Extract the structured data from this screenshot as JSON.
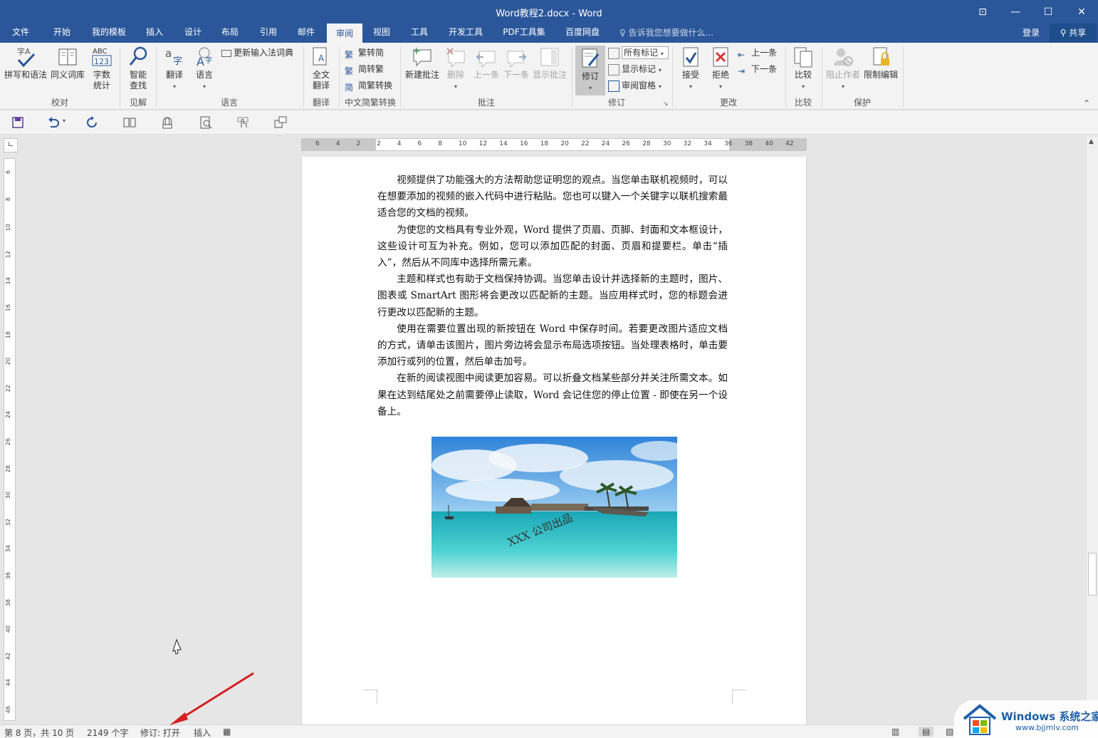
{
  "window": {
    "title": "Word教程2.docx - Word",
    "buttons": [
      "⊡",
      "—",
      "☐",
      "✕"
    ]
  },
  "tabs": [
    {
      "label": "文件"
    },
    {
      "label": "开始"
    },
    {
      "label": "我的模板"
    },
    {
      "label": "插入"
    },
    {
      "label": "设计"
    },
    {
      "label": "布局"
    },
    {
      "label": "引用"
    },
    {
      "label": "邮件"
    },
    {
      "label": "审阅",
      "active": true
    },
    {
      "label": "视图"
    },
    {
      "label": "工具"
    },
    {
      "label": "开发工具"
    },
    {
      "label": "PDF工具集"
    },
    {
      "label": "百度网盘"
    }
  ],
  "tellme": "告诉我您想要做什么...",
  "account": {
    "login": "登录",
    "share": "共享"
  },
  "ribbon": {
    "proofing": {
      "spell": "拼写和语法",
      "thesaurus": "同义词库",
      "wordcount": [
        "字数",
        "统计"
      ],
      "group": "校对"
    },
    "insights": {
      "smart_lookup": [
        "智能",
        "查找"
      ],
      "group": "见解"
    },
    "language": {
      "translate": "翻译",
      "language": "语言",
      "update_ime": "更新输入法词典",
      "group": "语言"
    },
    "translation": {
      "full_translate": [
        "全文",
        "翻译"
      ],
      "group": "翻译"
    },
    "chinese": {
      "to_simplified": "繁转简",
      "to_traditional": "简转繁",
      "convert": "简繁转换",
      "group": "中文简繁转换"
    },
    "comments": {
      "new": "新建批注",
      "delete": "删除",
      "previous": "上一条",
      "next": "下一条",
      "show": "显示批注",
      "group": "批注"
    },
    "tracking": {
      "track": "修订",
      "markup_select": "所有标记",
      "show_markup": "显示标记",
      "pane": "审阅窗格",
      "group": "修订"
    },
    "changes": {
      "accept": "接受",
      "reject": "拒绝",
      "previous": "上一条",
      "next": "下一条",
      "group": "更改"
    },
    "compare": {
      "compare": "比较",
      "group": "比较"
    },
    "protect": {
      "block_authors": "阻止作者",
      "restrict": "限制编辑",
      "group": "保护"
    }
  },
  "ruler": {
    "h_ticks": [
      "6",
      "4",
      "2",
      "2",
      "4",
      "6",
      "8",
      "10",
      "12",
      "14",
      "16",
      "18",
      "20",
      "22",
      "24",
      "26",
      "28",
      "30",
      "32",
      "34",
      "36",
      "38",
      "40",
      "42"
    ],
    "v_ticks": [
      "6",
      "8",
      "10",
      "12",
      "14",
      "16",
      "18",
      "20",
      "22",
      "24",
      "26",
      "28",
      "30",
      "32",
      "34",
      "36",
      "38",
      "40",
      "42",
      "44",
      "46"
    ]
  },
  "document": {
    "paragraphs": [
      "视频提供了功能强大的方法帮助您证明您的观点。当您单击联机视频时，可以在想要添加的视频的嵌入代码中进行粘贴。您也可以键入一个关键字以联机搜索最适合您的文档的视频。",
      "为使您的文档具有专业外观，Word 提供了页眉、页脚、封面和文本框设计，这些设计可互为补充。例如，您可以添加匹配的封面、页眉和提要栏。单击“插入”，然后从不同库中选择所需元素。",
      "主题和样式也有助于文档保持协调。当您单击设计并选择新的主题时，图片、图表或 SmartArt 图形将会更改以匹配新的主题。当应用样式时，您的标题会进行更改以匹配新的主题。",
      "使用在需要位置出现的新按钮在 Word 中保存时间。若要更改图片适应文档的方式，请单击该图片，图片旁边将会显示布局选项按钮。当处理表格时，单击要添加行或列的位置，然后单击加号。",
      "在新的阅读视图中阅读更加容易。可以折叠文档某些部分并关注所需文本。如果在达到结尾处之前需要停止读取，Word 会记住您的停止位置 - 即使在另一个设备上。"
    ],
    "image_watermark": "XXX 公司出品"
  },
  "status": {
    "page": "第 8 页，共 10 页",
    "words": "2149 个字",
    "track": "修订: 打开",
    "mode": "插入"
  },
  "brand": {
    "name": "Windows 系统之家",
    "url": "www.bjjmlv.com"
  },
  "colors": {
    "accent": "#2b579a",
    "arrow": "#d42020"
  }
}
